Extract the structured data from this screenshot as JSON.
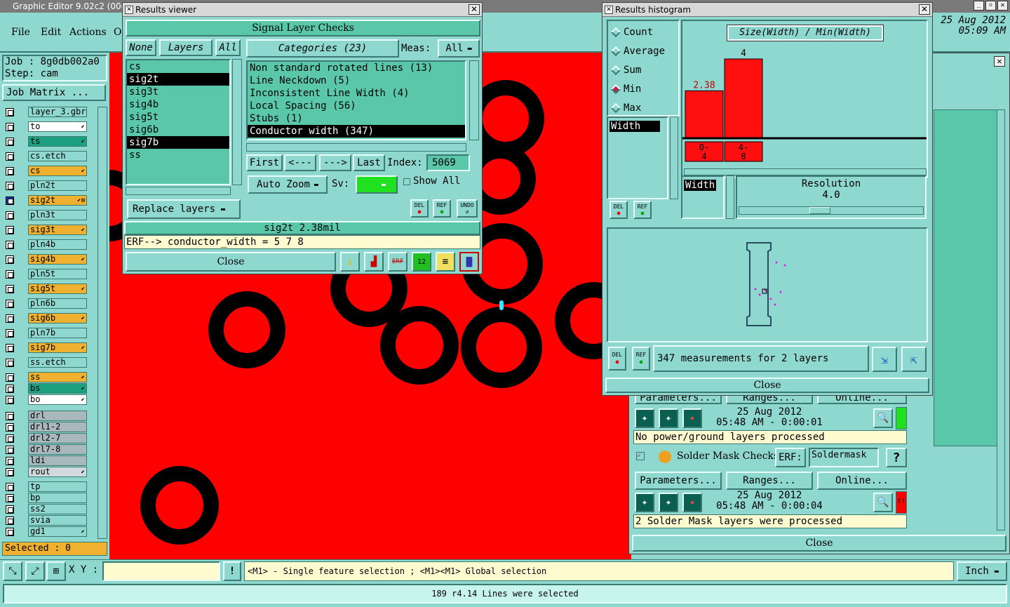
{
  "main": {
    "title": "Graphic Editor 9.02c2 (00@",
    "menu": [
      "File",
      "Edit",
      "Actions",
      "O"
    ],
    "date": "25 Aug 2012",
    "time": "05:09 AM",
    "job_label": "Job : 8g0db002a0",
    "step_label": "Step: cam",
    "job_matrix": "Job Matrix ...",
    "layers": [
      {
        "name": "layer_3.gbr",
        "style": "plain",
        "arrow": ""
      },
      {
        "name": "to",
        "style": "wh",
        "arrow": "⬋"
      },
      {
        "name": "ts",
        "style": "gr",
        "arrow": "⬋"
      },
      {
        "name": "cs.etch",
        "style": "plain",
        "arrow": ""
      },
      {
        "name": "cs",
        "style": "or",
        "arrow": "⬋"
      },
      {
        "name": "pln2t",
        "style": "plain",
        "arrow": ""
      },
      {
        "name": "sig2t",
        "style": "or",
        "arrow": "⬋⊞"
      },
      {
        "name": "pln3t",
        "style": "plain",
        "arrow": ""
      },
      {
        "name": "sig3t",
        "style": "or",
        "arrow": "⬋"
      },
      {
        "name": "pln4b",
        "style": "plain",
        "arrow": ""
      },
      {
        "name": "sig4b",
        "style": "or",
        "arrow": "⬋"
      },
      {
        "name": "pln5t",
        "style": "plain",
        "arrow": ""
      },
      {
        "name": "sig5t",
        "style": "or",
        "arrow": "⬋"
      },
      {
        "name": "pln6b",
        "style": "plain",
        "arrow": ""
      },
      {
        "name": "sig6b",
        "style": "or",
        "arrow": "⬋"
      },
      {
        "name": "pln7b",
        "style": "plain",
        "arrow": ""
      },
      {
        "name": "sig7b",
        "style": "or",
        "arrow": "⬋"
      },
      {
        "name": "ss.etch",
        "style": "plain",
        "arrow": ""
      },
      {
        "name": "ss",
        "style": "or",
        "arrow": "⬋"
      },
      {
        "name": "bs",
        "style": "gr",
        "arrow": "⬋"
      },
      {
        "name": "bo",
        "style": "wh",
        "arrow": "⬋"
      },
      {
        "name": "drl",
        "style": "gy",
        "arrow": ""
      },
      {
        "name": "drl1-2",
        "style": "gy",
        "arrow": ""
      },
      {
        "name": "drl2-7",
        "style": "gy",
        "arrow": ""
      },
      {
        "name": "drl7-8",
        "style": "gy",
        "arrow": ""
      },
      {
        "name": "ldi",
        "style": "gy",
        "arrow": ""
      },
      {
        "name": "rout",
        "style": "lg",
        "arrow": "⬋"
      },
      {
        "name": "tp",
        "style": "plain",
        "arrow": ""
      },
      {
        "name": "bp",
        "style": "plain",
        "arrow": ""
      },
      {
        "name": "ss2",
        "style": "plain",
        "arrow": ""
      },
      {
        "name": "svia",
        "style": "plain",
        "arrow": ""
      },
      {
        "name": "gd1",
        "style": "plain",
        "arrow": "⬋"
      }
    ],
    "selected": "Selected : 0",
    "xy_label": "X Y :",
    "xy_value": "",
    "hint": "<M1> - Single feature selection ; <M1><M1> Global selection",
    "units": "Inch",
    "status": "189 r4.14 Lines were selected"
  },
  "results_viewer": {
    "title": "Results viewer",
    "header": "Signal Layer Checks",
    "none": "None",
    "layers": "Layers",
    "all": "All",
    "layer_list": [
      "cs",
      "sig2t",
      "sig3t",
      "sig4b",
      "sig5t",
      "sig6b",
      "sig7b",
      "ss"
    ],
    "selected_layers": [
      "sig2t",
      "sig7b"
    ],
    "categories_btn": "Categories (23)",
    "meas_label": "Meas:",
    "meas_value": "All",
    "categories": [
      "Non standard rotated lines (13)",
      "Line Neckdown (5)",
      "Inconsistent Line Width (4)",
      "Local Spacing (56)",
      "Stubs (1)",
      "Conductor width (347)"
    ],
    "selected_category": "Conductor width (347)",
    "first": "First",
    "prev": "<---",
    "next": "--->",
    "last": "Last",
    "index_label": "Index:",
    "index_value": "5069",
    "auto_zoom": "Auto Zoom",
    "sv_label": "Sv:",
    "show_all": "Show All",
    "replace_layers": "Replace layers",
    "icon_del": "DEL",
    "icon_ref": "REF",
    "icon_undo": "UNDO",
    "info": "sig2t 2.38mil",
    "erf": "ERF--> conductor_width = 5 7 8",
    "close": "Close"
  },
  "histogram": {
    "title": "Results histogram",
    "modes": [
      "Count",
      "Average",
      "Sum",
      "Min",
      "Max"
    ],
    "selected_mode": "Min",
    "chart_title": "Size(Width) / Min(Width)",
    "list_item": "Width",
    "width_tag": "Width",
    "resolution_label": "Resolution",
    "resolution_value": "4.0",
    "summary": "347 measurements for 2 layers",
    "close": "Close"
  },
  "chart_data": {
    "type": "bar",
    "title": "Size(Width) / Min(Width)",
    "categories": [
      "0-4",
      "4-8"
    ],
    "values": [
      2.38,
      4
    ],
    "value_labels": [
      "2.38",
      "4"
    ],
    "ylim": [
      0,
      4.5
    ]
  },
  "checks": {
    "params_partial": "Parameters...",
    "ranges_partial": "Ranges...",
    "online_partial": "Online...",
    "run1_date": "25 Aug 2012",
    "run1_time": "05:48 AM - 0:00:01",
    "run1_msg": "No power/ground layers processed",
    "sm_title": "Solder Mask Checks",
    "erf_label": "ERF:",
    "erf_value": "Soldermask",
    "help": "?",
    "params": "Parameters...",
    "ranges": "Ranges...",
    "online": "Online...",
    "run2_date": "25 Aug 2012",
    "run2_time": "05:48 AM - 0:00:04",
    "run2_msg": "2 Solder Mask layers were processed",
    "close": "Close",
    "warn": "!!"
  },
  "colors": {
    "bg": "#8ed8d0",
    "red": "#ff0000",
    "panel_green": "#5ac8a8",
    "black": "#000000"
  }
}
